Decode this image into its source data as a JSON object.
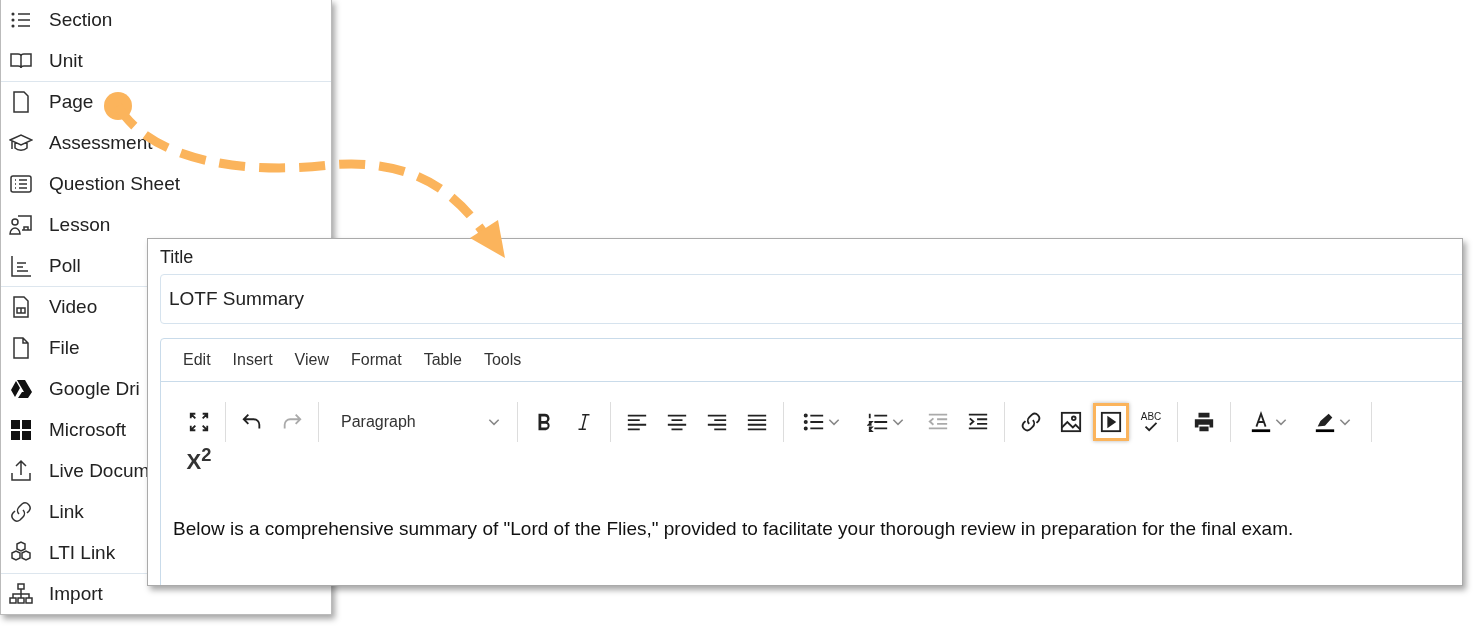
{
  "menu": {
    "groups": [
      [
        {
          "label": "Section",
          "kind": "list"
        },
        {
          "label": "Unit",
          "kind": "book"
        }
      ],
      [
        {
          "label": "Page",
          "kind": "page"
        },
        {
          "label": "Assessment",
          "kind": "cap"
        },
        {
          "label": "Question Sheet",
          "kind": "sheet"
        },
        {
          "label": "Lesson",
          "kind": "lesson"
        },
        {
          "label": "Poll",
          "kind": "poll"
        }
      ],
      [
        {
          "label": "Video",
          "kind": "video"
        },
        {
          "label": "File",
          "kind": "file"
        },
        {
          "label": "Google Dri",
          "kind": "drive"
        },
        {
          "label": "Microsoft",
          "kind": "windows"
        },
        {
          "label": "Live Docum",
          "kind": "upload"
        },
        {
          "label": "Link",
          "kind": "link"
        },
        {
          "label": "LTI Link",
          "kind": "cubes"
        }
      ],
      [
        {
          "label": "Import",
          "kind": "tree"
        }
      ]
    ]
  },
  "editor": {
    "title_label": "Title",
    "title_value": "LOTF Summary",
    "menubar": [
      "Edit",
      "Insert",
      "View",
      "Format",
      "Table",
      "Tools"
    ],
    "toolbar": [
      [
        {
          "kind": "fullscreen",
          "disabled": false,
          "highlighted": false
        }
      ],
      [
        {
          "kind": "undo",
          "disabled": false,
          "highlighted": false
        },
        {
          "kind": "redo",
          "disabled": true,
          "highlighted": false
        }
      ],
      [
        {
          "kind": "select",
          "label": "Paragraph",
          "disabled": false,
          "highlighted": false
        }
      ],
      [
        {
          "kind": "bold",
          "disabled": false,
          "highlighted": false
        },
        {
          "kind": "italic",
          "disabled": false,
          "highlighted": false
        }
      ],
      [
        {
          "kind": "align-left",
          "disabled": false,
          "highlighted": false
        },
        {
          "kind": "align-center",
          "disabled": false,
          "highlighted": false
        },
        {
          "kind": "align-right",
          "disabled": false,
          "highlighted": false
        },
        {
          "kind": "justify",
          "disabled": false,
          "highlighted": false
        }
      ],
      [
        {
          "kind": "bullets",
          "disabled": false,
          "highlighted": false
        },
        {
          "kind": "numbers",
          "disabled": false,
          "highlighted": false
        },
        {
          "kind": "outdent",
          "disabled": true,
          "highlighted": false
        },
        {
          "kind": "indent",
          "disabled": false,
          "highlighted": false
        }
      ],
      [
        {
          "kind": "link",
          "disabled": false,
          "highlighted": false
        },
        {
          "kind": "image",
          "disabled": false,
          "highlighted": false
        },
        {
          "kind": "media",
          "disabled": false,
          "highlighted": true
        },
        {
          "kind": "spellcheck",
          "label": "ABC",
          "disabled": false,
          "highlighted": false
        }
      ],
      [
        {
          "kind": "print",
          "disabled": false,
          "highlighted": false
        }
      ],
      [
        {
          "kind": "text-color",
          "disabled": false,
          "highlighted": false
        },
        {
          "kind": "highlight",
          "disabled": false,
          "highlighted": false
        }
      ],
      [
        {
          "kind": "superscript",
          "label": "X$^{2}$",
          "disabled": false,
          "highlighted": false
        }
      ]
    ],
    "body": "Below is a comprehensive summary of \"Lord of the Flies,\" provided to facilitate your thorough review in preparation for the final exam."
  }
}
